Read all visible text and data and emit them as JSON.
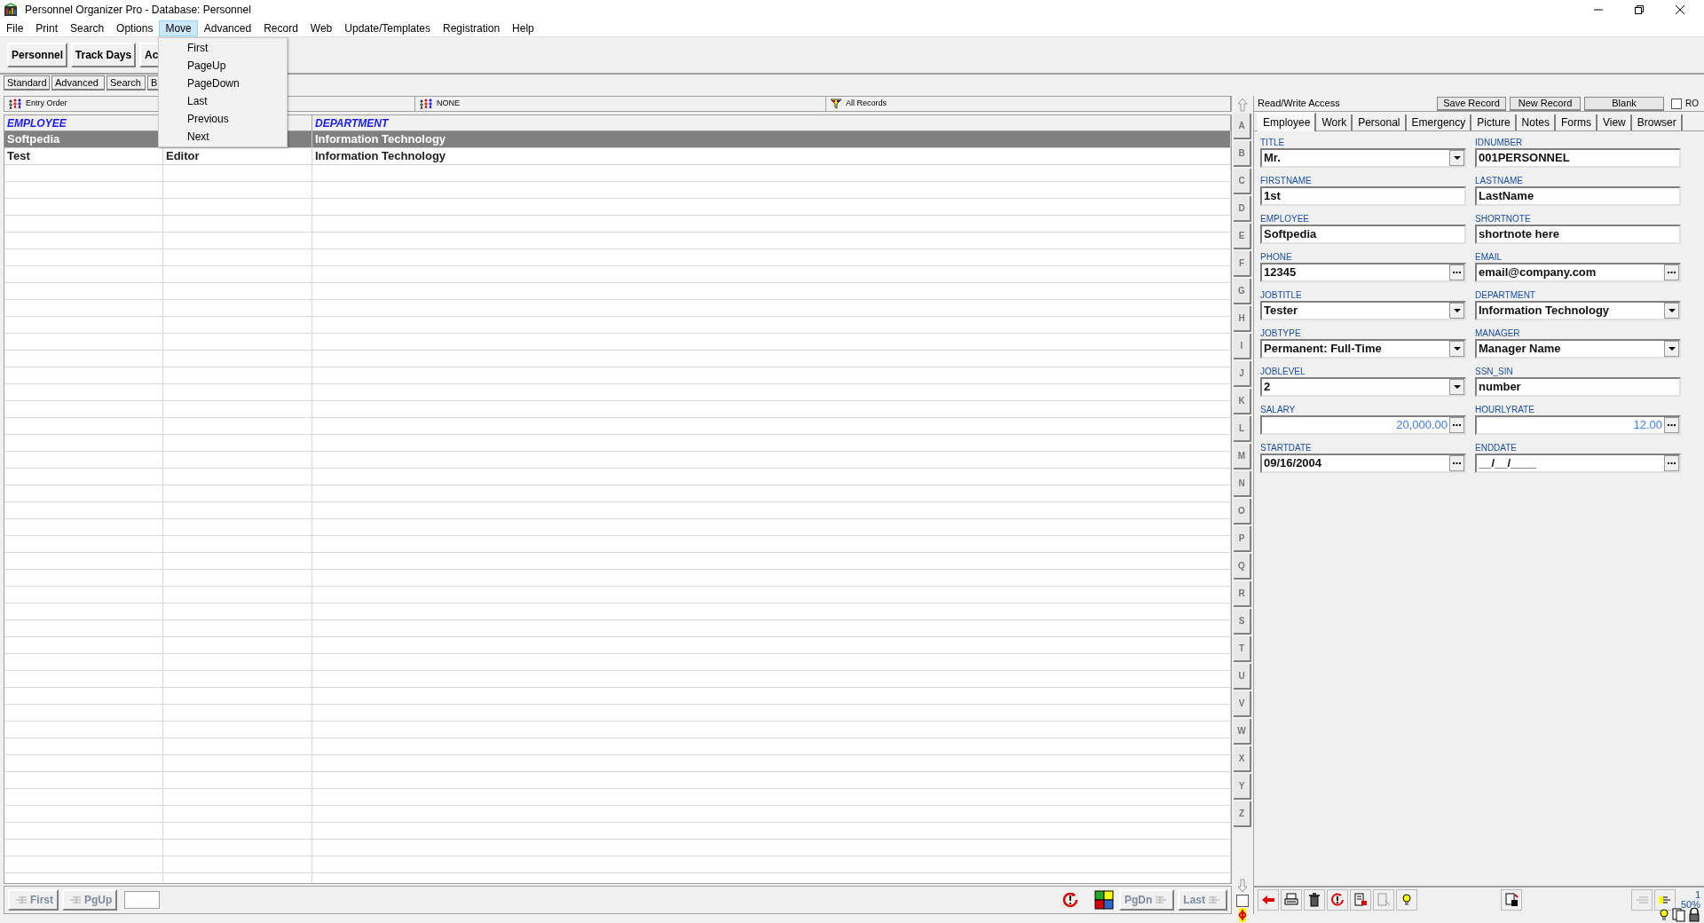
{
  "window": {
    "title": "Personnel Organizer Pro - Database: Personnel"
  },
  "menu_bar": [
    {
      "label": "File",
      "selected": false
    },
    {
      "label": "Print",
      "selected": false
    },
    {
      "label": "Search",
      "selected": false
    },
    {
      "label": "Options",
      "selected": false
    },
    {
      "label": "Move",
      "selected": true
    },
    {
      "label": "Advanced",
      "selected": false
    },
    {
      "label": "Record",
      "selected": false
    },
    {
      "label": "Web",
      "selected": false
    },
    {
      "label": "Update/Templates",
      "selected": false
    },
    {
      "label": "Registration",
      "selected": false
    },
    {
      "label": "Help",
      "selected": false
    }
  ],
  "move_menu": [
    "First",
    "PageUp",
    "PageDown",
    "Last",
    "Previous",
    "Next"
  ],
  "toolbar": [
    "Personnel",
    "Track Days",
    "Ac"
  ],
  "view_tabs": [
    "Standard",
    "Advanced",
    "Search",
    "B"
  ],
  "sort_bar": [
    {
      "kind": "people",
      "label": "Entry Order"
    },
    {
      "kind": "people",
      "label": "NONE"
    },
    {
      "kind": "filter",
      "label": "All Records"
    }
  ],
  "grid": {
    "column_1": "EMPLOYEE",
    "column_3": "DEPARTMENT",
    "rows": [
      {
        "cells": [
          "Softpedia",
          null,
          "Information Technology"
        ],
        "selected": true
      },
      {
        "cells": [
          "Test",
          "Editor",
          "Information Technology"
        ],
        "selected": false
      }
    ]
  },
  "alphabet": [
    "A",
    "B",
    "C",
    "D",
    "E",
    "F",
    "G",
    "H",
    "I",
    "J",
    "K",
    "L",
    "M",
    "N",
    "O",
    "P",
    "Q",
    "R",
    "S",
    "T",
    "U",
    "V",
    "W",
    "X",
    "Y",
    "Z"
  ],
  "strip_checkbox": {
    "checked": false
  },
  "nav_left": [
    {
      "label": "First",
      "disabled": true
    },
    {
      "label": "PgUp",
      "disabled": true
    }
  ],
  "nav_right": [
    {
      "label": "PgDn",
      "disabled": true
    },
    {
      "label": "Last",
      "disabled": true
    }
  ],
  "record_panel": {
    "access": "Read/Write Access",
    "buttons": [
      "Save Record",
      "New Record",
      "Blank"
    ],
    "ro": {
      "label": "RO",
      "checked": false
    },
    "tabs": [
      {
        "label": "Employee",
        "selected": true
      },
      {
        "label": "Work",
        "selected": false
      },
      {
        "label": "Personal",
        "selected": false
      },
      {
        "label": "Emergency",
        "selected": false
      },
      {
        "label": "Picture",
        "selected": false
      },
      {
        "label": "Notes",
        "selected": false
      },
      {
        "label": "Forms",
        "selected": false
      },
      {
        "label": "View",
        "selected": false
      },
      {
        "label": "Browser",
        "selected": false
      }
    ],
    "fields": [
      {
        "label": "TITLE",
        "value": "Mr.",
        "kind": "dropdown"
      },
      {
        "label": "IDNUMBER",
        "value": "001PERSONNEL",
        "kind": "text"
      },
      {
        "label": "FIRSTNAME",
        "value": "1st",
        "kind": "text"
      },
      {
        "label": "LASTNAME",
        "value": "LastName",
        "kind": "text"
      },
      {
        "label": "EMPLOYEE",
        "value": "Softpedia",
        "kind": "text"
      },
      {
        "label": "SHORTNOTE",
        "value": "shortnote here",
        "kind": "text"
      },
      {
        "label": "PHONE",
        "value": "12345",
        "kind": "ellipsis"
      },
      {
        "label": "EMAIL",
        "value": "email@company.com",
        "kind": "ellipsis"
      },
      {
        "label": "JOBTITLE",
        "value": "Tester",
        "kind": "dropdown"
      },
      {
        "label": "DEPARTMENT",
        "value": "Information Technology",
        "kind": "dropdown"
      },
      {
        "label": "JOBTYPE",
        "value": "Permanent: Full-Time",
        "kind": "dropdown"
      },
      {
        "label": "MANAGER",
        "value": "Manager Name",
        "kind": "dropdown"
      },
      {
        "label": "JOBLEVEL",
        "value": "2",
        "kind": "dropdown"
      },
      {
        "label": "SSN_SIN",
        "value": "number",
        "kind": "text"
      },
      {
        "label": "SALARY",
        "value": "20,000.00",
        "kind": "number"
      },
      {
        "label": "HOURLYRATE",
        "value": "12.00",
        "kind": "number"
      },
      {
        "label": "STARTDATE",
        "value": "09/16/2004",
        "kind": "ellipsis"
      },
      {
        "label": "ENDDATE",
        "value": "__/__/____",
        "kind": "ellipsis"
      }
    ]
  },
  "status": {
    "record": "1",
    "zoom": "50%"
  }
}
